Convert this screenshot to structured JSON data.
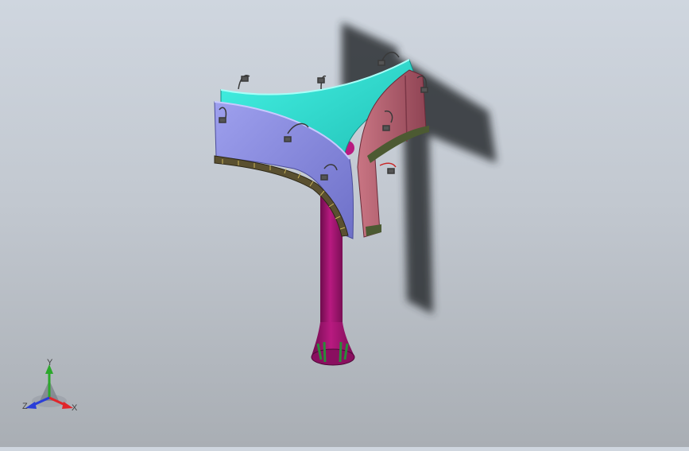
{
  "colors": {
    "background_top": "#cfd6df",
    "background_bottom": "#a9aeb4",
    "shadow": "#2b2e33",
    "panel_cyan": "#2fe0d2",
    "panel_blue": "#8c8ee0",
    "panel_pink": "#b5626f",
    "column": "#a0136e",
    "grille": "#5a5030"
  },
  "triad": {
    "x_label": "X",
    "y_label": "Y",
    "z_label": "Z",
    "x_color": "#e0262b",
    "y_color": "#2ba82b",
    "z_color": "#2a3ed8"
  }
}
